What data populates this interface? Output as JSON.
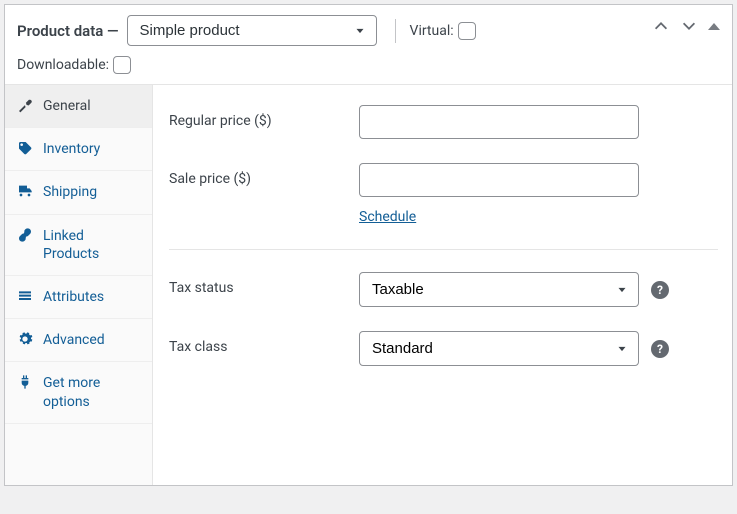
{
  "header": {
    "title": "Product data —",
    "type_selected": "Simple product",
    "virtual_label": "Virtual:",
    "downloadable_label": "Downloadable:"
  },
  "sidebar": {
    "items": [
      {
        "label": "General"
      },
      {
        "label": "Inventory"
      },
      {
        "label": "Shipping"
      },
      {
        "label": "Linked Products"
      },
      {
        "label": "Attributes"
      },
      {
        "label": "Advanced"
      },
      {
        "label": "Get more options"
      }
    ]
  },
  "fields": {
    "regular_price_label": "Regular price ($)",
    "regular_price_value": "",
    "sale_price_label": "Sale price ($)",
    "sale_price_value": "",
    "schedule_label": "Schedule",
    "tax_status_label": "Tax status",
    "tax_status_value": "Taxable",
    "tax_class_label": "Tax class",
    "tax_class_value": "Standard"
  }
}
